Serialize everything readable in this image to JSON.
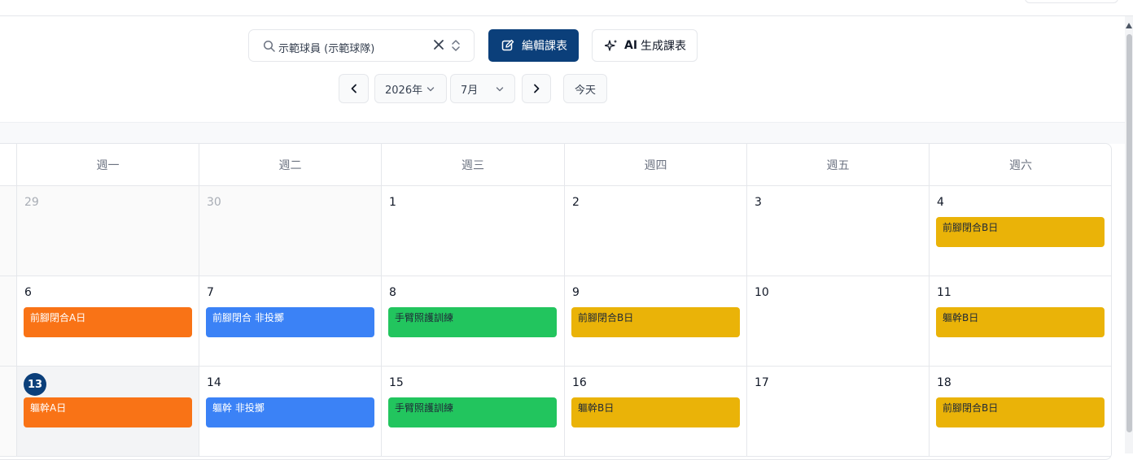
{
  "colors": {
    "primary": "#0b3f7a",
    "event_orange": "#f97316",
    "event_blue": "#3b82f6",
    "event_green": "#22c55e",
    "event_yellow": "#eab308"
  },
  "toolbar": {
    "search_value": "示範球員 (示範球隊)",
    "edit_label": "編輯課表",
    "ai_prefix": "AI",
    "ai_label": "生成課表",
    "year": "2026年",
    "month": "7月",
    "today": "今天",
    "icons": {
      "search": "search-icon",
      "clear": "close-icon",
      "updown": "chevron-up-down-icon",
      "edit": "edit-icon",
      "ai": "sparkles-icon",
      "prev": "chevron-left-icon",
      "next": "chevron-right-icon"
    }
  },
  "calendar": {
    "weekdays": [
      "週一",
      "週二",
      "週三",
      "週四",
      "週五",
      "週六"
    ],
    "weeks": [
      [
        {
          "day": "29",
          "muted": true,
          "events": []
        },
        {
          "day": "30",
          "muted": true,
          "events": []
        },
        {
          "day": "1",
          "events": []
        },
        {
          "day": "2",
          "events": []
        },
        {
          "day": "3",
          "events": []
        },
        {
          "day": "4",
          "events": [
            {
              "label": "前腳閉合B日",
              "color": "yellow"
            }
          ]
        }
      ],
      [
        {
          "day": "6",
          "events": [
            {
              "label": "前腳閉合A日",
              "color": "orange"
            }
          ]
        },
        {
          "day": "7",
          "events": [
            {
              "label": "前腳閉合 非投擲",
              "color": "blue"
            }
          ]
        },
        {
          "day": "8",
          "events": [
            {
              "label": "手臂照護訓練",
              "color": "green"
            }
          ]
        },
        {
          "day": "9",
          "events": [
            {
              "label": "前腳閉合B日",
              "color": "yellow"
            }
          ]
        },
        {
          "day": "10",
          "events": []
        },
        {
          "day": "11",
          "events": [
            {
              "label": "軀幹B日",
              "color": "yellow"
            }
          ]
        }
      ],
      [
        {
          "day": "13",
          "today": true,
          "events": [
            {
              "label": "軀幹A日",
              "color": "orange"
            }
          ]
        },
        {
          "day": "14",
          "events": [
            {
              "label": "軀幹 非投擲",
              "color": "blue"
            }
          ]
        },
        {
          "day": "15",
          "events": [
            {
              "label": "手臂照護訓練",
              "color": "green"
            }
          ]
        },
        {
          "day": "16",
          "events": [
            {
              "label": "軀幹B日",
              "color": "yellow"
            }
          ]
        },
        {
          "day": "17",
          "events": []
        },
        {
          "day": "18",
          "events": [
            {
              "label": "前腳閉合B日",
              "color": "yellow"
            }
          ]
        }
      ]
    ]
  }
}
